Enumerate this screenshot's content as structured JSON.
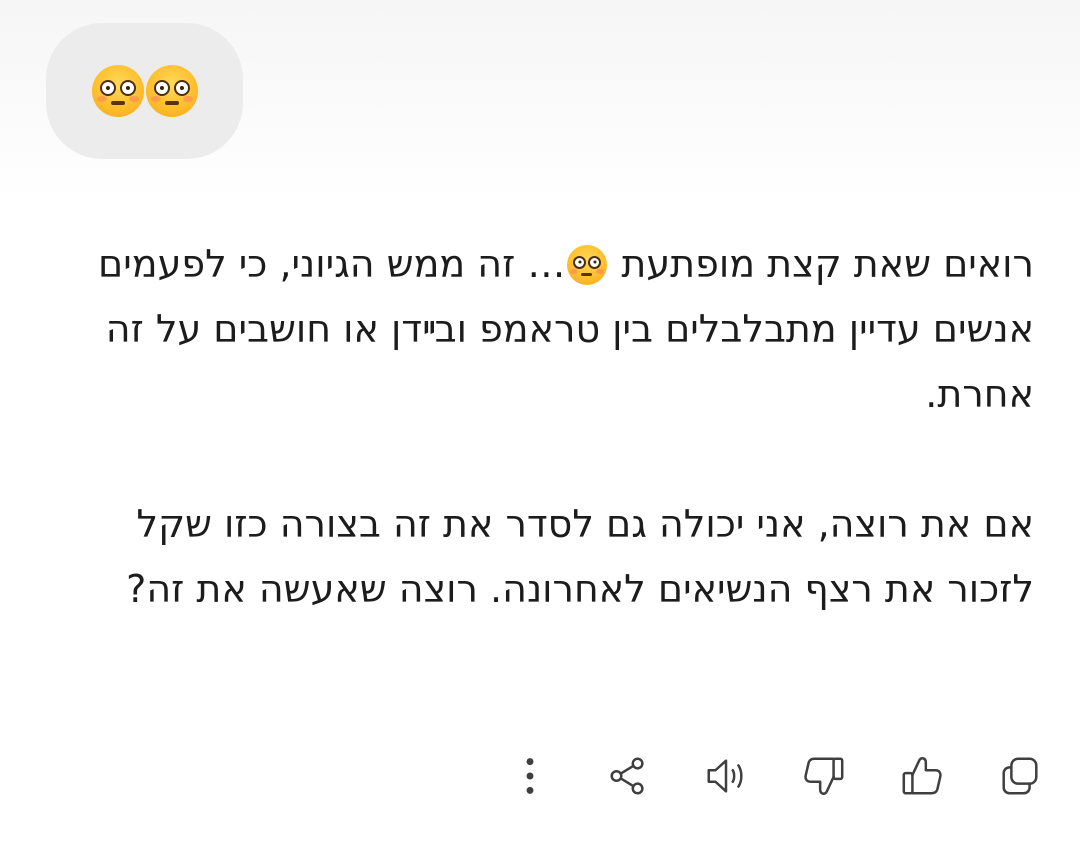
{
  "user_message": {
    "emojis": [
      "flushed-face",
      "flushed-face"
    ]
  },
  "assistant_message": {
    "p1_before_emoji": "רואים שאת קצת מופתעת",
    "p1_emoji": "flushed-face",
    "p1_after_emoji": "… זה ממש הגיוני, כי לפעמים אנשים עדיין מתבלבלים בין טראמפ ובײדן או חושבים על זה אחרת.",
    "p2": "אם את רוצה, אני יכולה גם לסדר את זה בצורה כזו שקל לזכור את רצף הנשיאים לאחרונה. רוצה שאעשה את זה?"
  },
  "action_bar": {
    "icons": [
      "copy-icon",
      "thumbs-up-icon",
      "thumbs-down-icon",
      "read-aloud-icon",
      "share-icon",
      "more-options-icon"
    ]
  }
}
